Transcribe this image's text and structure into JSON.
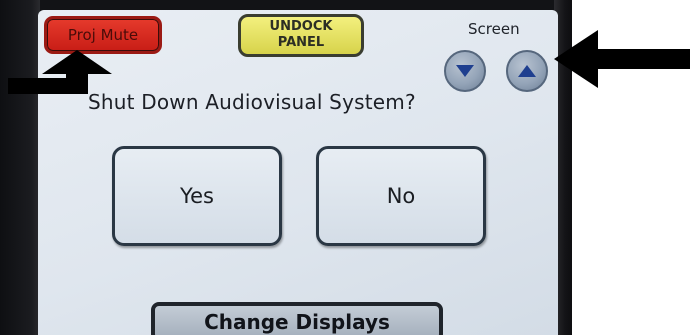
{
  "top_bar": {
    "proj_mute_label": "Proj Mute",
    "undock_label_line1": "UNDOCK",
    "undock_label_line2": "PANEL",
    "screen_label": "Screen"
  },
  "icons": {
    "scroll_down": "triangle-down-icon",
    "scroll_up": "triangle-up-icon",
    "annotation_left": "arrow-pointer-icon",
    "annotation_right": "arrow-pointer-icon"
  },
  "dialog": {
    "prompt": "Shut Down Audiovisual System?",
    "yes_label": "Yes",
    "no_label": "No"
  },
  "footer": {
    "change_displays_label": "Change Displays"
  },
  "colors": {
    "proj_mute_red": "#d6281e",
    "undock_yellow": "#e7e364",
    "screen_background": "#dfe6ee",
    "arrow_black": "#000000"
  }
}
